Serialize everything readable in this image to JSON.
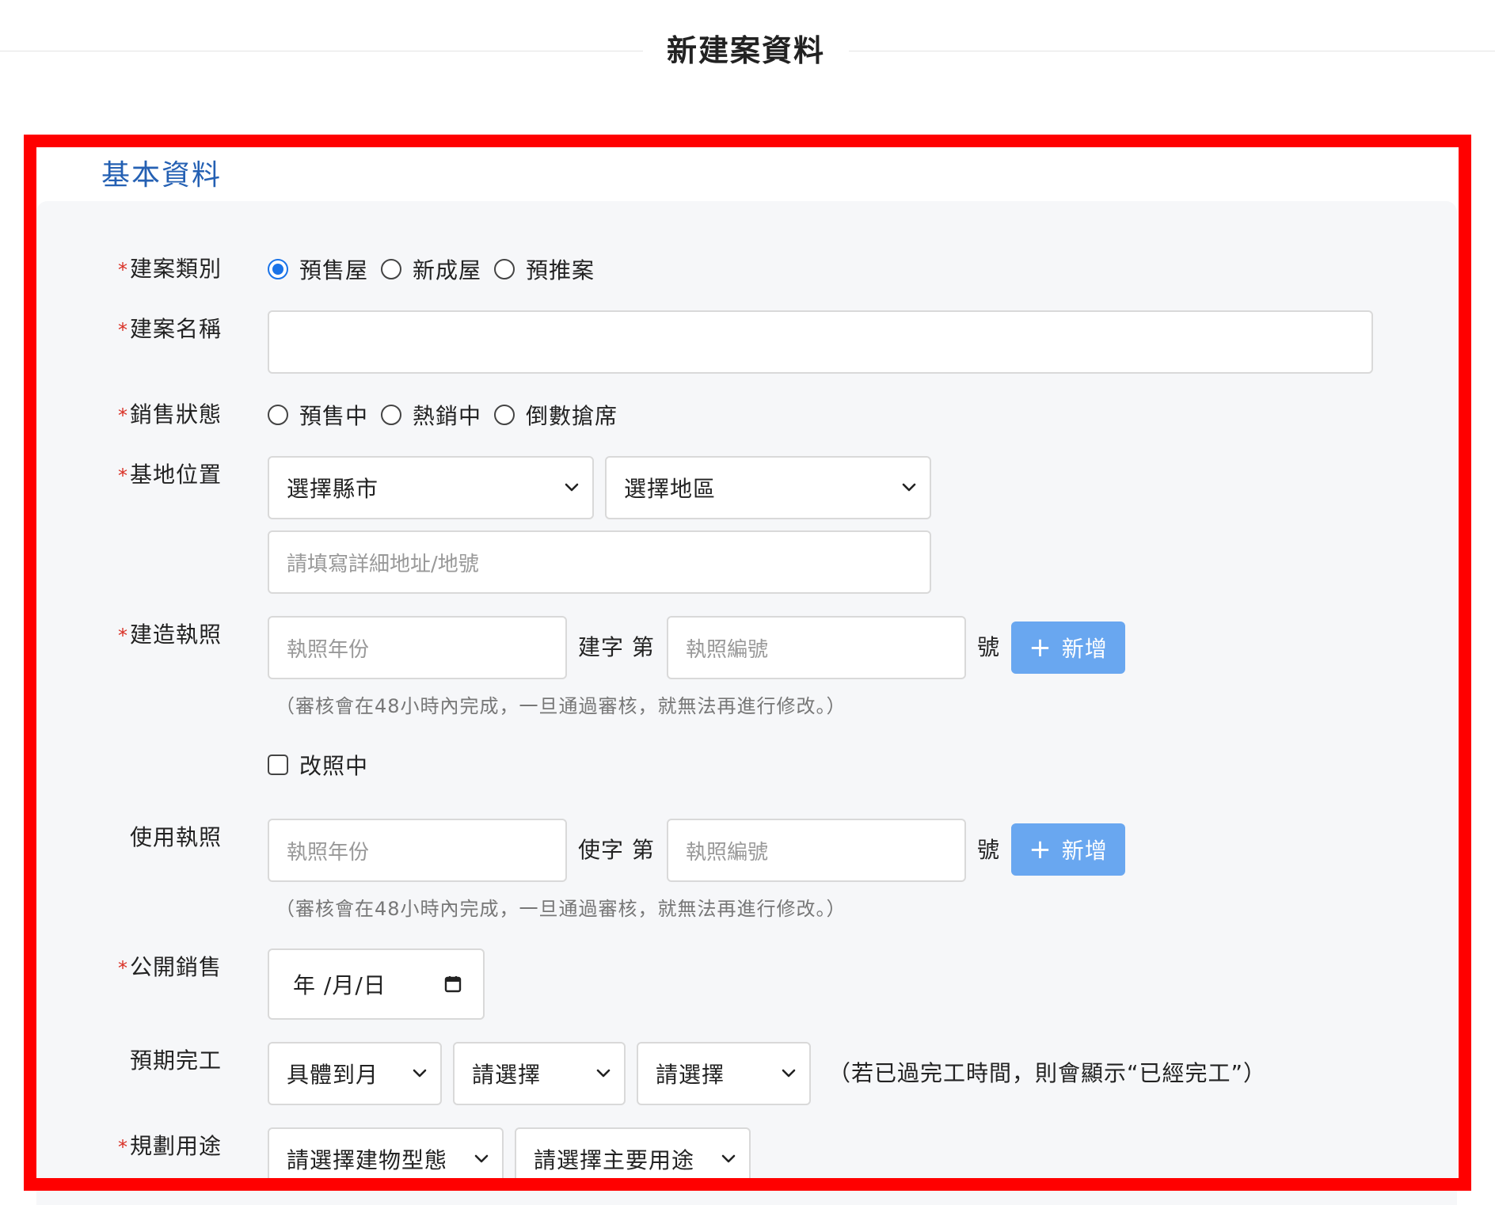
{
  "page": {
    "title": "新建案資料"
  },
  "section": {
    "heading": "基本資料"
  },
  "colors": {
    "highlight_border": "#ff0000",
    "section_heading": "#2460b3",
    "required_mark": "#d93025",
    "radio_checked": "#1a73e8",
    "add_button": "#69a7f0"
  },
  "fields": {
    "project_type": {
      "required": "*",
      "label": "建案類別",
      "options": [
        "預售屋",
        "新成屋",
        "預推案"
      ],
      "selected": "預售屋"
    },
    "project_name": {
      "required": "*",
      "label": "建案名稱",
      "value": ""
    },
    "sales_status": {
      "required": "*",
      "label": "銷售狀態",
      "options": [
        "預售中",
        "熱銷中",
        "倒數搶席"
      ]
    },
    "site_location": {
      "required": "*",
      "label": "基地位置",
      "city_select": "選擇縣市",
      "district_select": "選擇地區",
      "address_placeholder": "請填寫詳細地址/地號"
    },
    "building_permit": {
      "required": "*",
      "label": "建造執照",
      "year_placeholder": "執照年份",
      "mid_text": "建字 第",
      "number_placeholder": "執照編號",
      "suffix": "號",
      "add_label": "新增",
      "hint": "（審核會在48小時內完成，一旦通過審核，就無法再進行修改。）",
      "changing_label": "改照中"
    },
    "use_permit": {
      "label": "使用執照",
      "year_placeholder": "執照年份",
      "mid_text": "使字 第",
      "number_placeholder": "執照編號",
      "suffix": "號",
      "add_label": "新增",
      "hint": "（審核會在48小時內完成，一旦通過審核，就無法再進行修改。）"
    },
    "public_sale": {
      "required": "*",
      "label": "公開銷售",
      "date_display": "年 /月/日"
    },
    "expected_completion": {
      "label": "預期完工",
      "precision_select": "具體到月",
      "select_2": "請選擇",
      "select_3": "請選擇",
      "note": "（若已過完工時間，則會顯示“已經完工”）"
    },
    "planned_use": {
      "required": "*",
      "label": "規劃用途",
      "building_type_select": "請選擇建物型態",
      "main_use_select": "請選擇主要用途"
    }
  }
}
